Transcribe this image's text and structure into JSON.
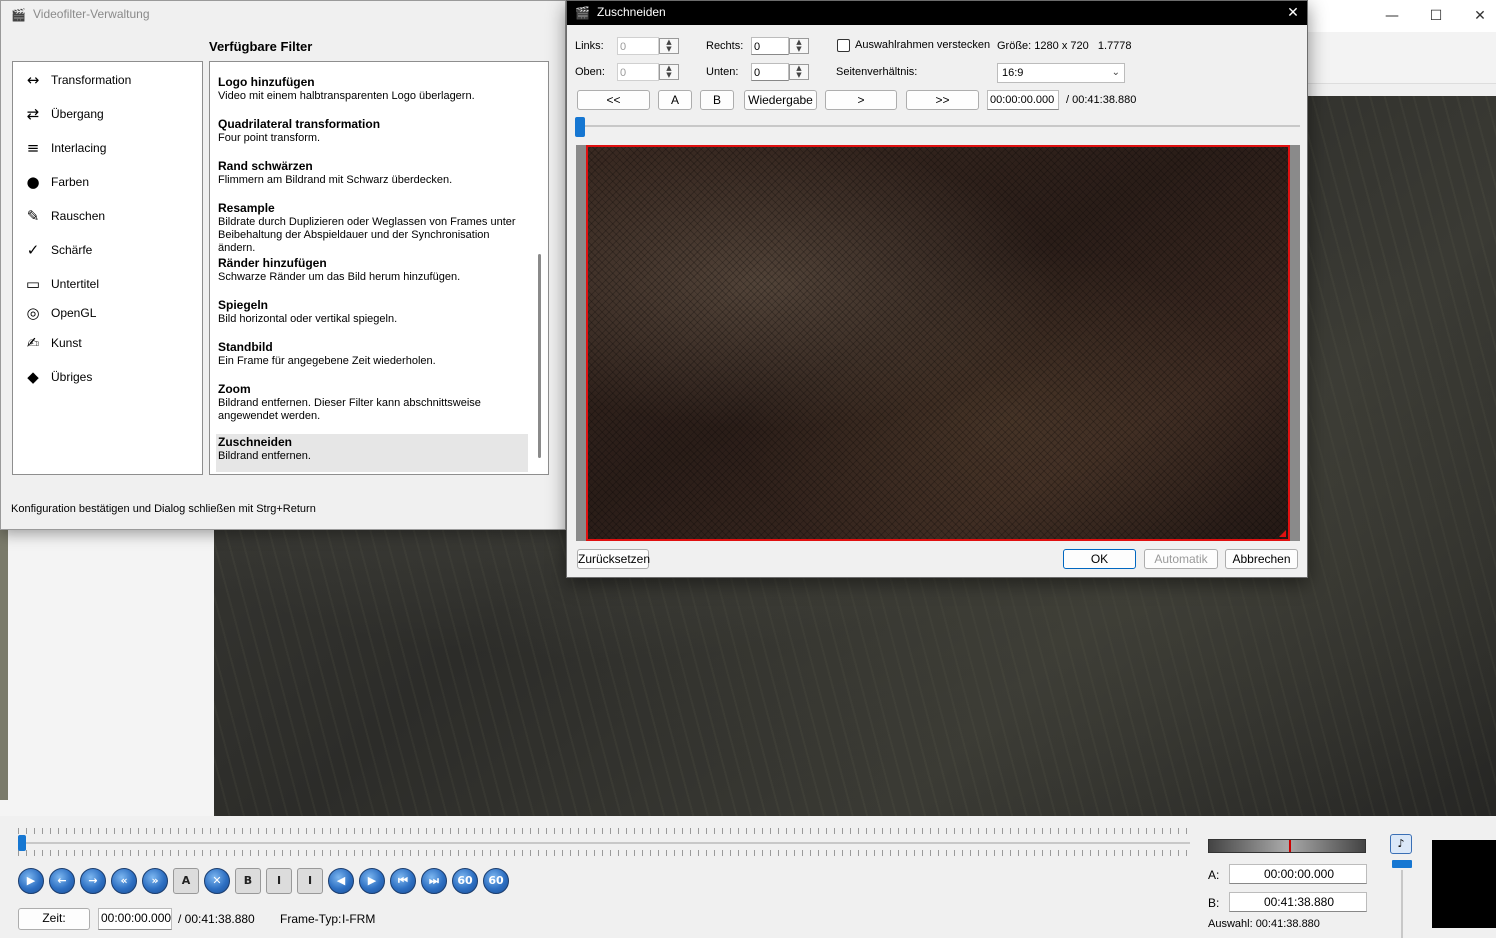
{
  "main": {
    "time_label": "Zeit:",
    "current_time": "00:00:00.000",
    "total_time": "/ 00:41:38.880",
    "frame_type_label": "Frame-Typ:",
    "frame_type": "I-FRM",
    "a_label": "A:",
    "a_value": "00:00:00.000",
    "b_label": "B:",
    "b_value": "00:41:38.880",
    "selection": "Auswahl: 00:41:38.880",
    "nav_buttons": [
      {
        "name": "play-icon",
        "glyph": "▶"
      },
      {
        "name": "previous-frame-icon",
        "glyph": "←"
      },
      {
        "name": "next-frame-icon",
        "glyph": "→"
      },
      {
        "name": "rewind-icon",
        "glyph": "«"
      },
      {
        "name": "fast-forward-icon",
        "glyph": "»"
      },
      {
        "name": "set-marker-a-icon",
        "glyph": "A"
      },
      {
        "name": "delete-icon",
        "glyph": "✕"
      },
      {
        "name": "set-marker-b-icon",
        "glyph": "B"
      },
      {
        "name": "goto-marker-a-icon",
        "glyph": "I"
      },
      {
        "name": "goto-marker-b-icon",
        "glyph": "I"
      },
      {
        "name": "previous-keyframe-icon",
        "glyph": "◀"
      },
      {
        "name": "next-keyframe-icon",
        "glyph": "▶"
      },
      {
        "name": "first-frame-icon",
        "glyph": "⏮"
      },
      {
        "name": "last-frame-icon",
        "glyph": "⏭"
      },
      {
        "name": "back-60s-icon",
        "glyph": "60"
      },
      {
        "name": "forward-60s-icon",
        "glyph": "60"
      }
    ]
  },
  "filter_manager": {
    "title": "Videofilter-Verwaltung",
    "heading": "Verfügbare Filter",
    "hint": "Konfiguration bestätigen und Dialog schließen mit Strg+Return",
    "categories": [
      {
        "label": "Transformation",
        "icon": "transformation-icon",
        "glyph": "↔"
      },
      {
        "label": "Übergang",
        "icon": "transition-icon",
        "glyph": "⇄"
      },
      {
        "label": "Interlacing",
        "icon": "interlacing-icon",
        "glyph": "≡"
      },
      {
        "label": "Farben",
        "icon": "colors-icon",
        "glyph": "●"
      },
      {
        "label": "Rauschen",
        "icon": "noise-icon",
        "glyph": "✎"
      },
      {
        "label": "Schärfe",
        "icon": "sharpness-icon",
        "glyph": "✓"
      },
      {
        "label": "Untertitel",
        "icon": "subtitle-icon",
        "glyph": "▭"
      },
      {
        "label": "OpenGL",
        "icon": "opengl-icon",
        "glyph": "◎"
      },
      {
        "label": "Kunst",
        "icon": "art-icon",
        "glyph": "✍"
      },
      {
        "label": "Übriges",
        "icon": "misc-icon",
        "glyph": "◆"
      }
    ],
    "filters": [
      {
        "name": "Logo hinzufügen",
        "desc": "Video mit einem halbtransparenten Logo überlagern."
      },
      {
        "name": "Quadrilateral transformation",
        "desc": "Four point transform."
      },
      {
        "name": "Rand schwärzen",
        "desc": "Flimmern am Bildrand mit Schwarz überdecken."
      },
      {
        "name": "Resample",
        "desc": "Bildrate durch Duplizieren oder Weglassen von Frames unter Beibehaltung der Abspieldauer und der Synchronisation ändern."
      },
      {
        "name": "Ränder hinzufügen",
        "desc": "Schwarze Ränder um das Bild herum hinzufügen."
      },
      {
        "name": "Spiegeln",
        "desc": "Bild horizontal oder vertikal spiegeln."
      },
      {
        "name": "Standbild",
        "desc": "Ein Frame für angegebene Zeit wiederholen."
      },
      {
        "name": "Zoom",
        "desc": "Bildrand entfernen. Dieser Filter kann abschnittsweise angewendet werden."
      },
      {
        "name": "Zuschneiden",
        "desc": "Bildrand entfernen."
      }
    ]
  },
  "crop": {
    "title": "Zuschneiden",
    "left_label": "Links:",
    "left_value": "0",
    "right_label": "Rechts:",
    "right_value": "0",
    "top_label": "Oben:",
    "top_value": "0",
    "bottom_label": "Unten:",
    "bottom_value": "0",
    "hide_frame_label": "Auswahlrahmen verstecken",
    "size_text": "Größe: 1280 x 720   1.7778",
    "aspect_label": "Seitenverhältnis:",
    "aspect_value": "16:9",
    "btn_prev": "<<",
    "btn_a": "A",
    "btn_b": "B",
    "btn_play": "Wiedergabe",
    "btn_next": ">",
    "btn_next2": ">>",
    "time": "00:00:00.000",
    "total": "/ 00:41:38.880",
    "reset": "Zurücksetzen",
    "ok": "OK",
    "auto": "Automatik",
    "cancel": "Abbrechen"
  }
}
